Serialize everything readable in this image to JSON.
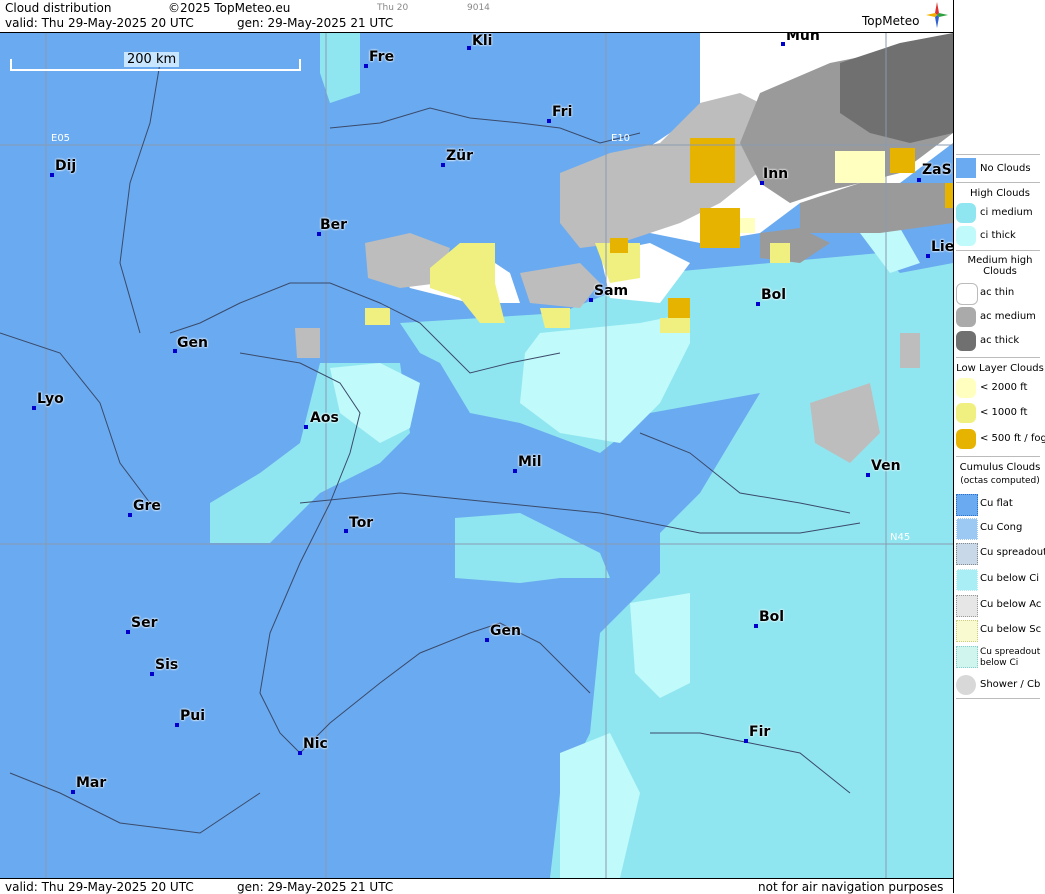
{
  "header": {
    "product": "Cloud distribution",
    "copyright": "©2025 TopMeteo.eu",
    "tiny1": "Thu 20",
    "tiny2": "9014",
    "valid": "valid:  Thu  29-May-2025  20 UTC",
    "gen": "gen: 29-May-2025 21 UTC",
    "logo": "TopMeteo"
  },
  "footer": {
    "valid": "valid:  Thu  29-May-2025  20 UTC",
    "gen": "gen: 29-May-2025 21 UTC",
    "disclaimer": "not for air navigation purposes"
  },
  "map": {
    "scale_label": "200 km",
    "grid_labels": [
      "E05",
      "E10",
      "N45"
    ],
    "cities": [
      {
        "name": "Kli"
      },
      {
        "name": "Fre"
      },
      {
        "name": "Mün"
      },
      {
        "name": "Fri"
      },
      {
        "name": "Dij"
      },
      {
        "name": "Zür"
      },
      {
        "name": "Inn"
      },
      {
        "name": "ZaS"
      },
      {
        "name": "Ber"
      },
      {
        "name": "Lie"
      },
      {
        "name": "Sam"
      },
      {
        "name": "Bol"
      },
      {
        "name": "Gen"
      },
      {
        "name": "Lyo"
      },
      {
        "name": "Aos"
      },
      {
        "name": "Mil"
      },
      {
        "name": "Ven"
      },
      {
        "name": "Gre"
      },
      {
        "name": "Tor"
      },
      {
        "name": "Ser"
      },
      {
        "name": "Gen"
      },
      {
        "name": "Bol"
      },
      {
        "name": "Sis"
      },
      {
        "name": "Pui"
      },
      {
        "name": "Nic"
      },
      {
        "name": "Fir"
      },
      {
        "name": "Mar"
      }
    ]
  },
  "legend": {
    "no_clouds": "No Clouds",
    "high_title": "High Clouds",
    "high": [
      "ci medium",
      "ci thick"
    ],
    "medium_title": "Medium high Clouds",
    "medium": [
      "ac thin",
      "ac medium",
      "ac thick"
    ],
    "low_title": "Low Layer Clouds",
    "low": [
      "< 2000 ft",
      "< 1000 ft",
      "< 500 ft / fog"
    ],
    "cu_title": "Cumulus Clouds",
    "cu_sub": "(octas computed)",
    "cu": [
      "Cu flat",
      "Cu Cong",
      "Cu spreadout",
      "Cu below Ci",
      "Cu below Ac",
      "Cu below Sc",
      "Cu spreadout below Ci",
      "Shower / Cb"
    ],
    "colors": {
      "no_clouds": "#6aaaf0",
      "ci_medium": "#90e6f0",
      "ci_thick": "#c0fafa",
      "ac_thin": "#ffffff",
      "ac_medium": "#aaaaaa",
      "ac_thick": "#707070",
      "low_2000": "#ffffc0",
      "low_1000": "#f0f080",
      "low_500": "#e6b400"
    }
  }
}
